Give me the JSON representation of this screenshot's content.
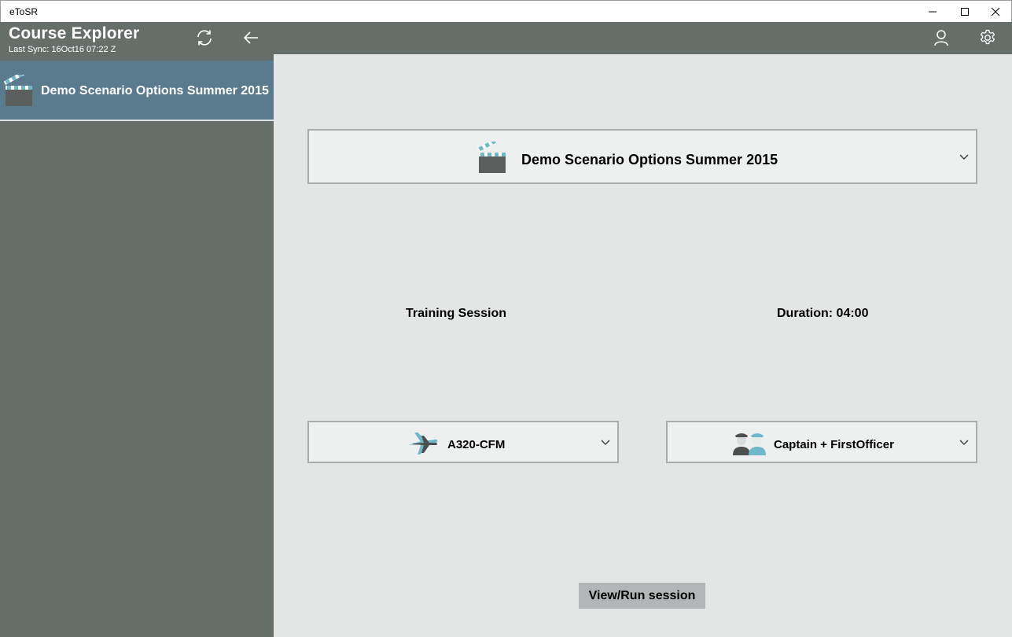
{
  "window": {
    "title": "eToSR"
  },
  "header": {
    "app_title": "Course Explorer",
    "last_sync": "Last Sync: 16Oct16 07:22 Z"
  },
  "sidebar": {
    "items": [
      {
        "label": "Demo Scenario Options Summer 2015",
        "icon": "clapperboard-icon"
      }
    ]
  },
  "main": {
    "scenario_select": {
      "value": "Demo Scenario Options Summer 2015"
    },
    "training_session_label": "Training Session",
    "duration_label": "Duration: 04:00",
    "aircraft_select": {
      "value": "A320-CFM"
    },
    "crew_select": {
      "value": "Captain + FirstOfficer"
    },
    "run_button": "View/Run session"
  },
  "colors": {
    "header_bg": "#666e6a",
    "sidebar_selected": "#5a7b8e",
    "main_bg": "#e4e6e6",
    "accent_teal": "#5fb0c4"
  }
}
